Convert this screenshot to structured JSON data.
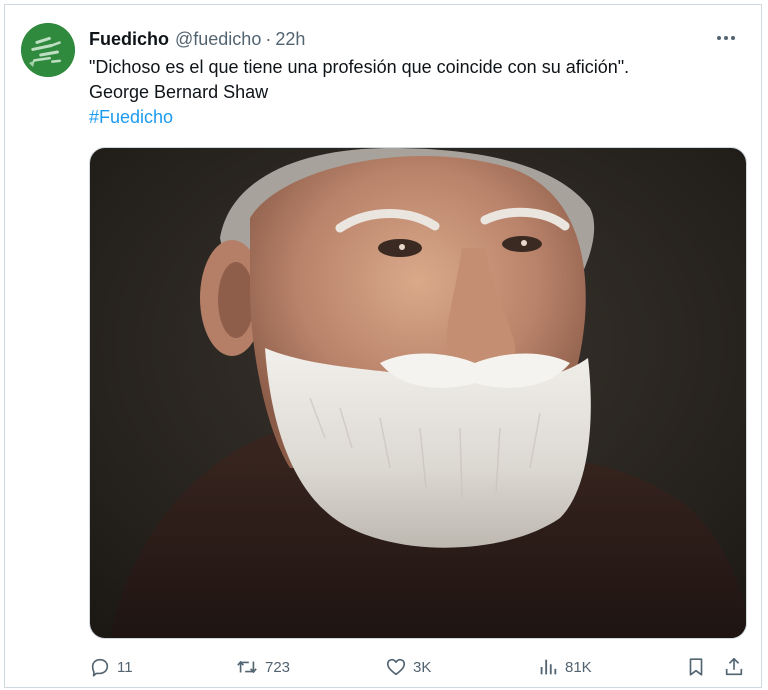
{
  "tweet": {
    "display_name": "Fuedicho",
    "handle": "@fuedicho",
    "separator": "·",
    "time": "22h",
    "text_line1": "\"Dichoso es el que tiene una profesión que coincide con su afición\".",
    "text_line2": "George Bernard Shaw",
    "hashtag": "#Fuedicho",
    "media_description_icon": "portrait-photo",
    "accent_color": "#1d9bf0"
  },
  "actions": {
    "replies": "11",
    "retweets": "723",
    "likes": "3K",
    "views": "81K"
  },
  "icons": {
    "more": "more-horizontal-icon",
    "reply": "reply-icon",
    "retweet": "retweet-icon",
    "like": "heart-icon",
    "views": "views-chart-icon",
    "bookmark": "bookmark-icon",
    "share": "share-icon"
  }
}
